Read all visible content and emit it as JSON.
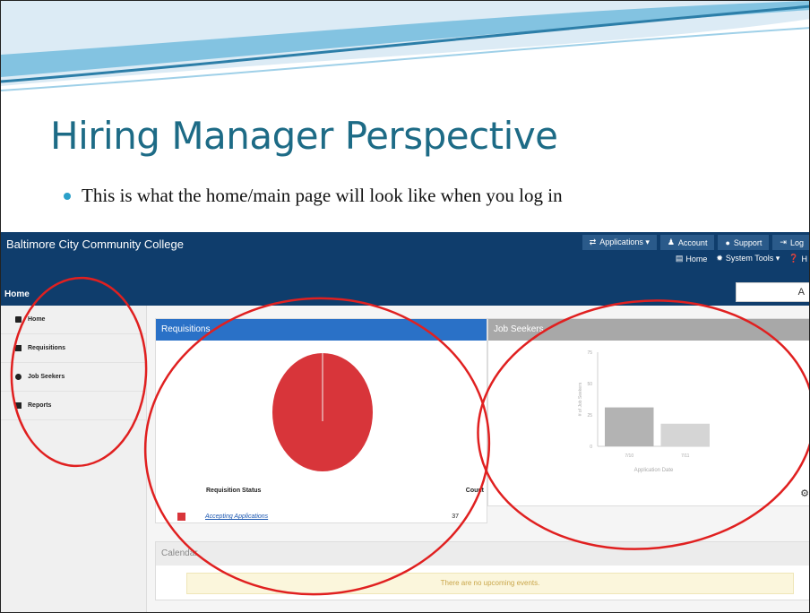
{
  "slide": {
    "title": "Hiring Manager Perspective",
    "bullet": "This is what the home/main page will look like when you log in"
  },
  "app": {
    "org_name": "Baltimore City Community College",
    "top_nav": [
      {
        "icon": "swap-icon",
        "label": "Applications ▾"
      },
      {
        "icon": "user-icon",
        "label": "Account"
      },
      {
        "icon": "info-icon",
        "label": "Support"
      },
      {
        "icon": "logout-icon",
        "label": "Log"
      }
    ],
    "sub_nav": [
      {
        "icon": "home-icon",
        "label": "Home"
      },
      {
        "icon": "gear-icon",
        "label": "System Tools ▾"
      },
      {
        "icon": "help-icon",
        "label": "H"
      }
    ],
    "page_label": "Home",
    "search_value": "A",
    "sidebar": [
      {
        "icon": "home-icon",
        "label": "Home"
      },
      {
        "icon": "book-icon",
        "label": "Requisitions"
      },
      {
        "icon": "users-icon",
        "label": "Job Seekers"
      },
      {
        "icon": "folder-icon",
        "label": "Reports"
      }
    ],
    "requisitions": {
      "title": "Requisitions",
      "col_status": "Requisition Status",
      "col_count": "Count",
      "rows": [
        {
          "status": "Accepting Applications",
          "count": "37",
          "color": "#d8353a"
        }
      ]
    },
    "job_seekers": {
      "title": "Job Seekers"
    },
    "calendar": {
      "title": "Calendar",
      "empty_message": "There are no upcoming events."
    }
  },
  "chart_data": [
    {
      "type": "pie",
      "categories": [
        "Accepting Applications"
      ],
      "values": [
        37
      ],
      "colors": [
        "#d8353a"
      ]
    },
    {
      "type": "bar",
      "categories": [
        "7/10",
        "7/11"
      ],
      "values": [
        31,
        18
      ],
      "ylim": [
        0,
        75
      ],
      "yticks": [
        0,
        25,
        50,
        75
      ],
      "ylabel": "# of Job Seekers",
      "xlabel": "Application Date",
      "colors": [
        "#b3b3b3",
        "#d5d5d5"
      ]
    }
  ]
}
